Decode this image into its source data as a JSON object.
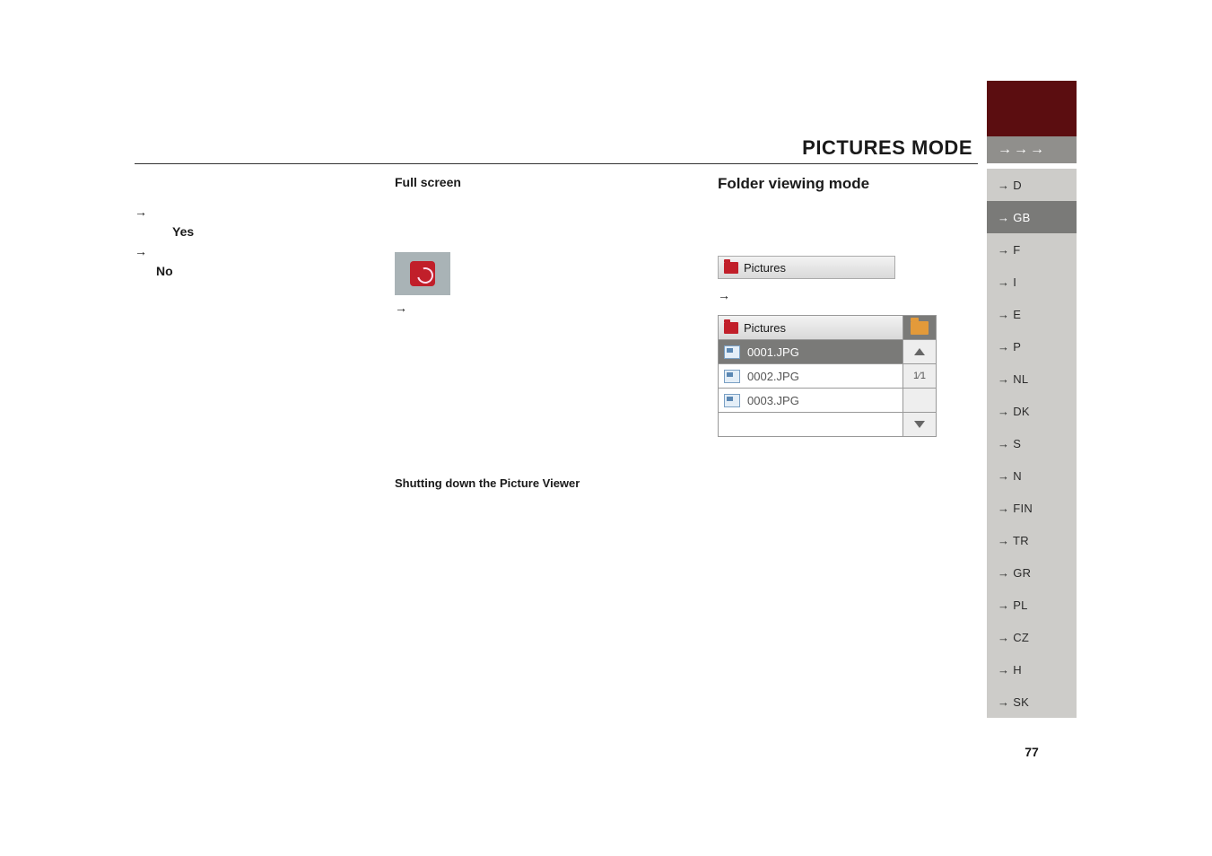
{
  "header": {
    "title": "PICTURES MODE",
    "arrows": "→→→"
  },
  "left": {
    "yes": "Yes",
    "no": "No"
  },
  "mid": {
    "heading": "Full screen",
    "thumb_arrow": "→",
    "section2": "Shutting down the Picture Viewer"
  },
  "right": {
    "heading": "Folder viewing mode",
    "panel_label": "Pictures",
    "panel_arrow": "→",
    "file_header": "Pictures",
    "files": {
      "f1": "0001.JPG",
      "f2": "0002.JPG",
      "f3": "0003.JPG"
    },
    "pager": "1⁄1"
  },
  "sidebar": {
    "items": {
      "d": "→ D",
      "gb": "→ GB",
      "f": "→ F",
      "i": "→ I",
      "e": "→ E",
      "p": "→ P",
      "nl": "→ NL",
      "dk": "→ DK",
      "s": "→ S",
      "n": "→ N",
      "fin": "→ FIN",
      "tr": "→ TR",
      "gr": "→ GR",
      "pl": "→ PL",
      "cz": "→ CZ",
      "h": "→ H",
      "sk": "→ SK"
    }
  },
  "page_number": "77"
}
